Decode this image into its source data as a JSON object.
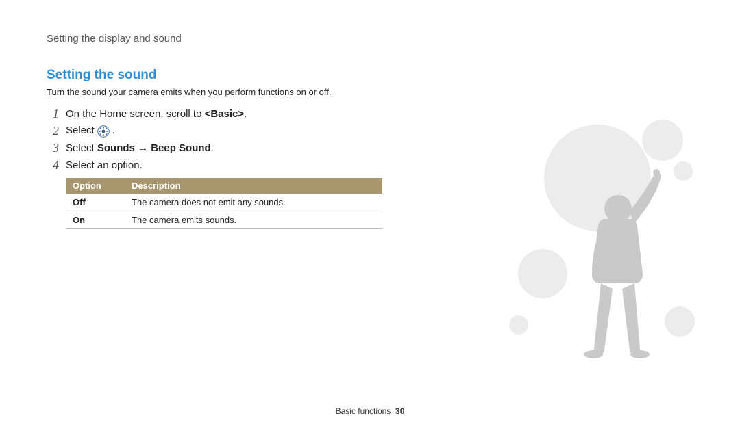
{
  "breadcrumb": "Setting the display and sound",
  "section": {
    "title": "Setting the sound",
    "desc": "Turn the sound your camera emits when you perform functions on or off."
  },
  "steps": {
    "s1_pre": "On the Home screen, scroll to ",
    "s1_bold": "<Basic>",
    "s1_post": ".",
    "s2_pre": "Select ",
    "s2_post": ".",
    "s3_pre": "Select ",
    "s3_bold_a": "Sounds",
    "s3_arrow": " → ",
    "s3_bold_b": "Beep Sound",
    "s3_post": ".",
    "s4": "Select an option."
  },
  "table": {
    "head_option": "Option",
    "head_desc": "Description",
    "rows": [
      {
        "opt": "Off",
        "desc": "The camera does not emit any sounds."
      },
      {
        "opt": "On",
        "desc": "The camera emits sounds."
      }
    ]
  },
  "footer": {
    "section_label": "Basic functions",
    "page_number": "30"
  },
  "icons": {
    "settings_gear": "settings-gear-icon"
  }
}
